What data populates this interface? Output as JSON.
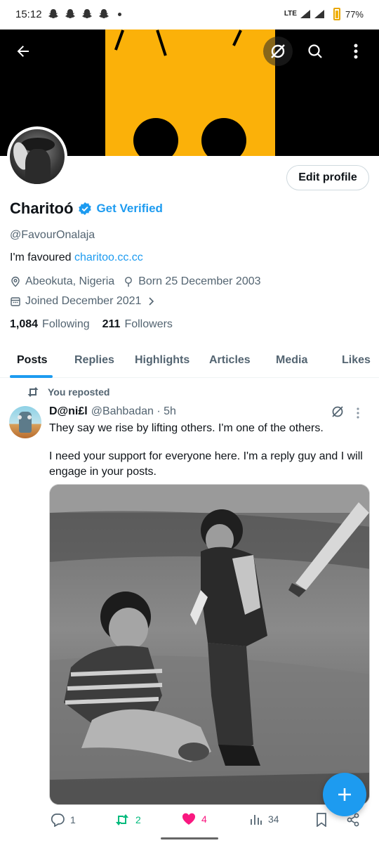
{
  "status_bar": {
    "time": "15:12",
    "network": "LTE",
    "battery": "77%",
    "battery_level": 0.77
  },
  "profile": {
    "name": "Charitoó",
    "get_verified": "Get Verified",
    "handle": "@FavourOnalaja",
    "bio_text": "I'm favoured ",
    "bio_link": "charitoo.cc.cc",
    "location": "Abeokuta, Nigeria",
    "born": "Born 25 December 2003",
    "joined": "Joined December 2021",
    "following_count": "1,084",
    "following_label": "Following",
    "followers_count": "211",
    "followers_label": "Followers",
    "edit_button": "Edit profile"
  },
  "tabs": [
    "Posts",
    "Replies",
    "Highlights",
    "Articles",
    "Media",
    "Likes"
  ],
  "active_tab": "Posts",
  "post": {
    "repost_label": "You reposted",
    "author_name": "D@ni£l",
    "author_handle": "@Bahbadan · 5h",
    "text_1": "They say we rise by lifting others. I'm one of the others.",
    "text_2": "I need your support for everyone here. I'm a reply guy and I will engage in your posts.",
    "replies": "1",
    "reposts": "2",
    "likes": "4",
    "views": "34"
  },
  "colors": {
    "accent": "#1d9bf0",
    "repost_green": "#00ba7c",
    "like_pink": "#f91880",
    "banner_yellow": "#fbb109"
  },
  "icons": [
    "back-arrow-icon",
    "grok-icon",
    "search-icon",
    "more-vertical-icon",
    "verified-badge-icon",
    "location-icon",
    "birthday-icon",
    "calendar-icon",
    "chevron-right-icon",
    "repost-icon",
    "reply-icon",
    "like-icon",
    "views-icon",
    "bookmark-icon",
    "share-icon",
    "compose-plus-icon"
  ]
}
